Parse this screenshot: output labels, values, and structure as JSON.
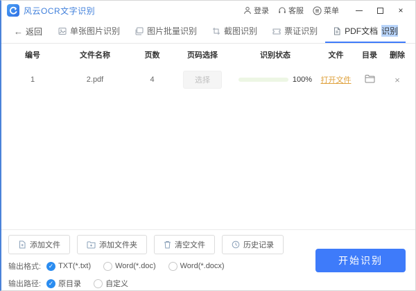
{
  "window": {
    "title": "风云OCR文字识别",
    "user_actions": [
      {
        "label": "登录"
      },
      {
        "label": "客服"
      },
      {
        "label": "菜单"
      }
    ],
    "controls": {
      "minimize": "",
      "maximize": "",
      "close": "×"
    }
  },
  "nav": {
    "back_arrow": "←",
    "back_label": "返回",
    "tabs": [
      {
        "label": "单张图片识别"
      },
      {
        "label": "图片批量识别"
      },
      {
        "label": "截图识别"
      },
      {
        "label": "票证识别"
      },
      {
        "label": "PDF文档",
        "highlight": "识别",
        "active": true
      }
    ]
  },
  "table": {
    "headers": [
      "编号",
      "文件名称",
      "页数",
      "页码选择",
      "识别状态",
      "文件",
      "目录",
      "删除"
    ],
    "rows": [
      {
        "index": "1",
        "filename": "2.pdf",
        "pages": "4",
        "page_select_label": "选择",
        "progress_percent": "100%",
        "open_file_label": "打开文件",
        "delete_icon": "×"
      }
    ]
  },
  "toolbar": {
    "buttons": [
      {
        "label": "添加文件"
      },
      {
        "label": "添加文件夹"
      },
      {
        "label": "清空文件"
      },
      {
        "label": "历史记录"
      }
    ]
  },
  "options": {
    "format_label": "输出格式:",
    "formats": [
      {
        "label": "TXT(*.txt)",
        "checked": true
      },
      {
        "label": "Word(*.doc)",
        "checked": false
      },
      {
        "label": "Word(*.docx)",
        "checked": false
      }
    ],
    "path_label": "输出路径:",
    "paths": [
      {
        "label": "原目录",
        "checked": true
      },
      {
        "label": "自定义",
        "checked": false
      }
    ]
  },
  "actions": {
    "start_label": "开始识别"
  },
  "icons": {
    "check": "✓"
  },
  "colors": {
    "accent": "#3e7bfa",
    "progress_green": "#55b71f",
    "link_orange": "#dfa13c",
    "title_blue": "#3f7fdb"
  }
}
